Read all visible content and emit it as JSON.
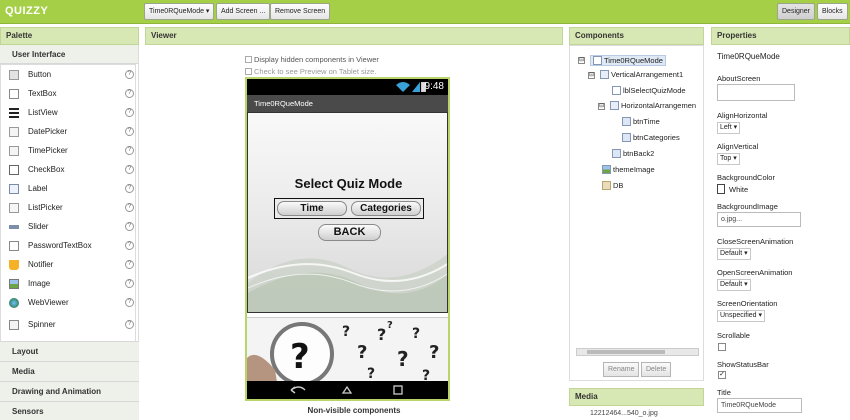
{
  "app": {
    "title": "QUIZZY"
  },
  "toolbar": {
    "screen_selector": "Time0RQueMode ▾",
    "add_screen": "Add Screen ...",
    "remove_screen": "Remove Screen",
    "designer": "Designer",
    "blocks": "Blocks"
  },
  "palette": {
    "header": "Palette",
    "section": "User Interface",
    "items": [
      {
        "label": "Button",
        "icon": "button-icon"
      },
      {
        "label": "TextBox",
        "icon": "textbox-icon"
      },
      {
        "label": "ListView",
        "icon": "listview-icon"
      },
      {
        "label": "DatePicker",
        "icon": "datepicker-icon"
      },
      {
        "label": "TimePicker",
        "icon": "timepicker-icon"
      },
      {
        "label": "CheckBox",
        "icon": "checkbox-icon"
      },
      {
        "label": "Label",
        "icon": "label-icon"
      },
      {
        "label": "ListPicker",
        "icon": "listpicker-icon"
      },
      {
        "label": "Slider",
        "icon": "slider-icon"
      },
      {
        "label": "PasswordTextBox",
        "icon": "password-icon"
      },
      {
        "label": "Notifier",
        "icon": "notifier-icon"
      },
      {
        "label": "Image",
        "icon": "image-icon"
      },
      {
        "label": "WebViewer",
        "icon": "webviewer-icon"
      },
      {
        "label": "Spinner",
        "icon": "spinner-icon"
      }
    ],
    "help_glyph": "?",
    "categories": [
      "Layout",
      "Media",
      "Drawing and Animation",
      "Sensors"
    ]
  },
  "viewer": {
    "header": "Viewer",
    "show_hidden": "Display hidden components in Viewer",
    "tablet_preview": "Check to see Preview on Tablet size.",
    "status_time": "9:48",
    "screen_title": "Time0RQueMode",
    "quiz_title": "Select Quiz Mode",
    "btn_time": "Time",
    "btn_categories": "Categories",
    "btn_back": "BACK",
    "nonvisible": "Non-visible components"
  },
  "components": {
    "header": "Components",
    "tree": [
      {
        "label": "Time0RQueMode",
        "level": 0
      },
      {
        "label": "VerticalArrangement1",
        "level": 1
      },
      {
        "label": "lblSelectQuizMode",
        "level": 2
      },
      {
        "label": "HorizontalArrangemen",
        "level": 2
      },
      {
        "label": "btnTime",
        "level": 3
      },
      {
        "label": "btnCategories",
        "level": 3
      },
      {
        "label": "btnBack2",
        "level": 2
      },
      {
        "label": "themeImage",
        "level": 1
      },
      {
        "label": "DB",
        "level": 1
      }
    ],
    "toggle_minus": "⊟",
    "rename": "Rename",
    "delete": "Delete"
  },
  "media": {
    "header": "Media",
    "item": "12212464...540_o.jpg"
  },
  "properties": {
    "header": "Properties",
    "component": "Time0RQueMode",
    "about_screen": "AboutScreen",
    "align_horizontal": "AlignHorizontal",
    "align_horizontal_value": "Left ▾",
    "align_vertical": "AlignVertical",
    "align_vertical_value": "Top ▾",
    "background_color": "BackgroundColor",
    "background_color_value": "White",
    "background_image": "BackgroundImage",
    "background_image_value": "o.jpg...",
    "close_anim": "CloseScreenAnimation",
    "close_anim_value": "Default ▾",
    "open_anim": "OpenScreenAnimation",
    "open_anim_value": "Default ▾",
    "orientation": "ScreenOrientation",
    "orientation_value": "Unspecified ▾",
    "scrollable": "Scrollable",
    "show_status_bar": "ShowStatusBar",
    "show_status_bar_check": "✓",
    "title": "Title",
    "title_value": "Time0RQueMode"
  }
}
